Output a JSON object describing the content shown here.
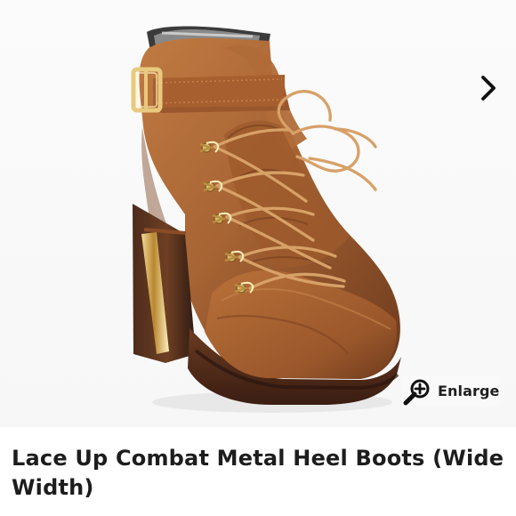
{
  "product": {
    "title": "Lace Up Combat Metal Heel Boots (Wide Width)"
  },
  "image_viewer": {
    "enlarge_label": "Enlarge",
    "next_icon": "chevron-right-icon",
    "zoom_icon": "magnifier-plus-icon"
  },
  "colors": {
    "leather": "#a96635",
    "leather_dark": "#6f3d1f",
    "heel_metal": "#d6b26a",
    "lace": "#c48443",
    "background": "#ffffff"
  }
}
